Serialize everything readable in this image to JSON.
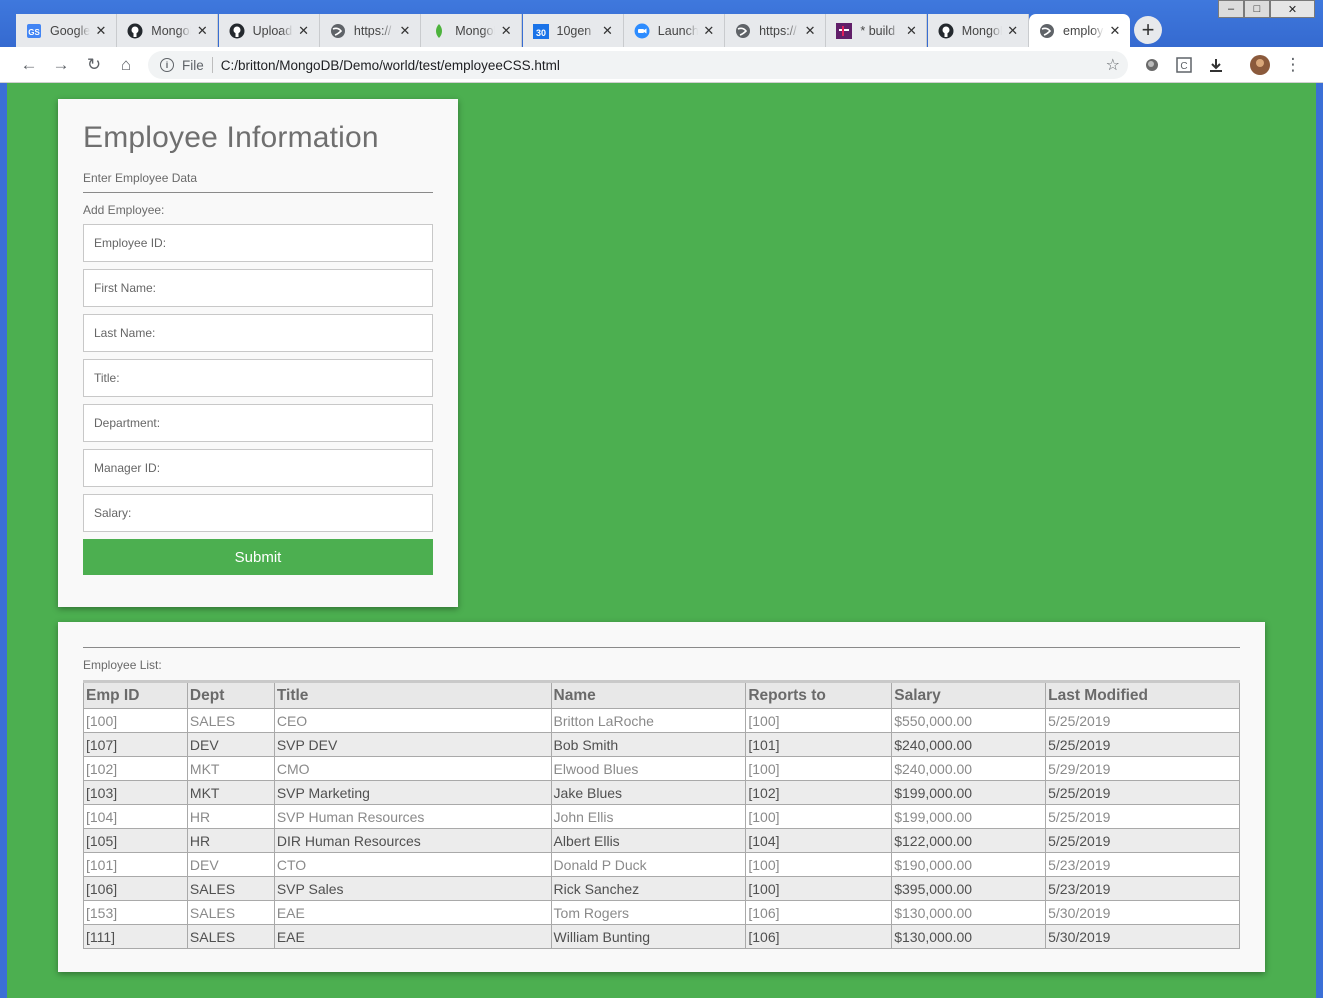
{
  "browser": {
    "tabs": [
      {
        "title": "Google",
        "icon": "google-docs-icon",
        "color": "#4285f4"
      },
      {
        "title": "MongoDB",
        "icon": "github-icon",
        "color": "#24292e"
      },
      {
        "title": "Upload",
        "icon": "github-icon",
        "color": "#24292e"
      },
      {
        "title": "https://",
        "icon": "globe-icon",
        "color": "#5f6368"
      },
      {
        "title": "MongoDB",
        "icon": "mongodb-leaf-icon",
        "color": "#4db33d"
      },
      {
        "title": "10gen",
        "icon": "calendar-icon",
        "color": "#1a73e8"
      },
      {
        "title": "Launch",
        "icon": "zoom-icon",
        "color": "#2d8cff"
      },
      {
        "title": "https://",
        "icon": "globe-icon",
        "color": "#5f6368"
      },
      {
        "title": "* build",
        "icon": "slack-icon",
        "color": "#611f69"
      },
      {
        "title": "MongoDB",
        "icon": "github-icon",
        "color": "#24292e"
      },
      {
        "title": "employeeCSS",
        "icon": "globe-icon",
        "color": "#5f6368"
      }
    ],
    "active_tab": 10,
    "scheme_label": "File",
    "url": "C:/britton/MongoDB/Demo/world/test/employeeCSS.html"
  },
  "form": {
    "title": "Employee Information",
    "subtitle": "Enter Employee Data",
    "add_label": "Add Employee:",
    "fields": {
      "emp_id": "Employee ID:",
      "first_name": "First Name:",
      "last_name": "Last Name:",
      "title": "Title:",
      "department": "Department:",
      "manager_id": "Manager ID:",
      "salary": "Salary:"
    },
    "submit_label": "Submit"
  },
  "list": {
    "label": "Employee List:",
    "columns": [
      "Emp ID",
      "Dept",
      "Title",
      "Name",
      "Reports to",
      "Salary",
      "Last Modified"
    ],
    "rows": [
      [
        "[100]",
        "SALES",
        "CEO",
        "Britton LaRoche",
        "[100]",
        "$550,000.00",
        "5/25/2019"
      ],
      [
        "[107]",
        "DEV",
        "SVP DEV",
        "Bob Smith",
        "[101]",
        "$240,000.00",
        "5/25/2019"
      ],
      [
        "[102]",
        "MKT",
        "CMO",
        "Elwood Blues",
        "[100]",
        "$240,000.00",
        "5/29/2019"
      ],
      [
        "[103]",
        "MKT",
        "SVP Marketing",
        "Jake Blues",
        "[102]",
        "$199,000.00",
        "5/25/2019"
      ],
      [
        "[104]",
        "HR",
        "SVP Human Resources",
        "John Ellis",
        "[100]",
        "$199,000.00",
        "5/25/2019"
      ],
      [
        "[105]",
        "HR",
        "DIR Human Resources",
        "Albert Ellis",
        "[104]",
        "$122,000.00",
        "5/25/2019"
      ],
      [
        "[101]",
        "DEV",
        "CTO",
        "Donald P Duck",
        "[100]",
        "$190,000.00",
        "5/23/2019"
      ],
      [
        "[106]",
        "SALES",
        "SVP Sales",
        "Rick Sanchez",
        "[100]",
        "$395,000.00",
        "5/23/2019"
      ],
      [
        "[153]",
        "SALES",
        "EAE",
        "Tom Rogers",
        "[106]",
        "$130,000.00",
        "5/30/2019"
      ],
      [
        "[111]",
        "SALES",
        "EAE",
        "William Bunting",
        "[106]",
        "$130,000.00",
        "5/30/2019"
      ]
    ]
  },
  "colors": {
    "page_bg": "#4caf50",
    "accent": "#4caf50"
  }
}
